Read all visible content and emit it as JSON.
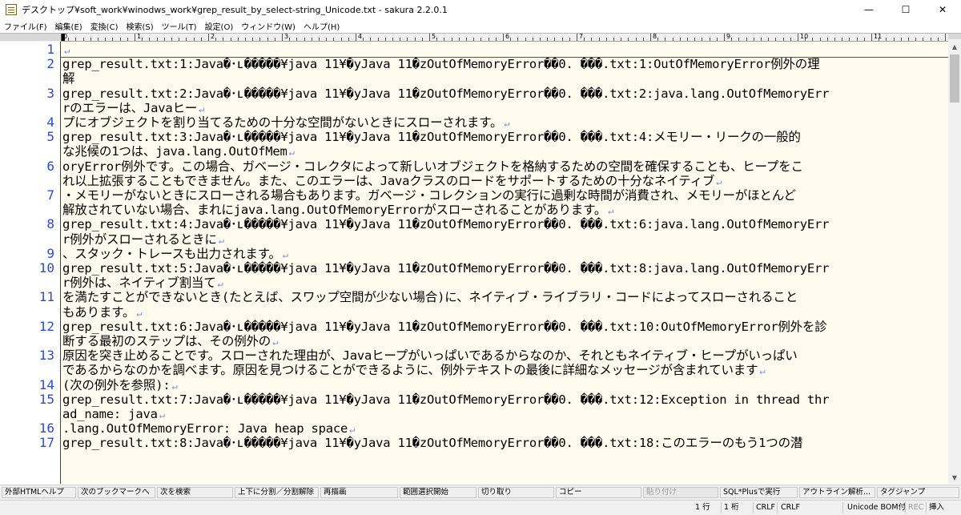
{
  "window": {
    "title": "デスクトップ¥soft_work¥winodws_work¥grep_result_by_select-string_Unicode.txt - sakura 2.2.0.1",
    "min_glyph": "—",
    "max_glyph": "☐",
    "close_glyph": "✕"
  },
  "menu": [
    "ファイル(F)",
    "編集(E)",
    "変換(C)",
    "検索(S)",
    "ツール(T)",
    "設定(O)",
    "ウィンドウ(W)",
    "ヘルプ(H)"
  ],
  "ruler": {
    "labels": [
      "0",
      "1",
      "2",
      "3",
      "4",
      "5",
      "6",
      "7",
      "8",
      "9",
      "10",
      "11",
      "12"
    ]
  },
  "editor": {
    "line_numbers": [
      "1",
      "2",
      "",
      "3",
      "",
      "4",
      "5",
      "",
      "6",
      "",
      "7",
      "",
      "8",
      "",
      "9",
      "10",
      "",
      "11",
      "",
      "12",
      "",
      "13",
      "",
      "14",
      "15",
      "",
      "16",
      "17"
    ],
    "rows": [
      "↵",
      "grep_result.txt:1:Java�･ʟ�����¥java 11¥�yJava 11�zOutOfMemoryError��0. ���.txt:1:OutOfMemoryError例外の理",
      "解",
      "grep_result.txt:2:Java�･ʟ�����¥java 11¥�yJava 11�zOutOfMemoryError��0. ���.txt:2:java.lang.OutOfMemoryErr",
      "rのエラーは、Javaヒー↵",
      "プにオブジェクトを割り当てるための十分な空間がないときにスローされます。↵",
      "grep_result.txt:3:Java�･ʟ�����¥java 11¥�yJava 11�zOutOfMemoryError��0. ���.txt:4:メモリー・リークの一般的",
      "な兆候の1つは、java.lang.OutOfMem↵",
      "oryError例外です。この場合、ガベージ・コレクタによって新しいオブジェクトを格納するための空間を確保することも、ヒープをこ",
      "れ以上拡張することもできません。また、このエラーは、Javaクラスのロードをサポートするための十分なネイティブ↵",
      "・メモリーがないときにスローされる場合もあります。ガベージ・コレクションの実行に過剰な時間が消費され、メモリーがほとんど",
      "解放されていない場合、まれにjava.lang.OutOfMemoryErrorがスローされることがあります。↵",
      "grep_result.txt:4:Java�･ʟ�����¥java 11¥�yJava 11�zOutOfMemoryError��0. ���.txt:6:java.lang.OutOfMemoryErr",
      "r例外がスローされるときに↵",
      "、スタック・トレースも出力されます。↵",
      "grep_result.txt:5:Java�･ʟ�����¥java 11¥�yJava 11�zOutOfMemoryError��0. ���.txt:8:java.lang.OutOfMemoryErr",
      "r例外は、ネイティブ割当て↵",
      "を満たすことができないとき(たとえば、スワップ空間が少ない場合)に、ネイティブ・ライブラリ・コードによってスローされること",
      "もあります。↵",
      "grep_result.txt:6:Java�･ʟ�����¥java 11¥�yJava 11�zOutOfMemoryError��0. ���.txt:10:OutOfMemoryError例外を診",
      "断する最初のステップは、その例外の↵",
      "原因を突き止めることです。スローされた理由が、Javaヒープがいっぱいであるからなのか、それともネイティブ・ヒープがいっぱい",
      "であるからなのかを調べます。原因を見つけることができるように、例外テキストの最後に詳細なメッセージが含まれています↵",
      "(次の例外を参照):↵",
      "grep_result.txt:7:Java�･ʟ�����¥java 11¥�yJava 11�zOutOfMemoryError��0. ���.txt:12:Exception in thread thr",
      "ad_name: java↵",
      ".lang.OutOfMemoryError: Java heap space↵",
      "grep_result.txt:8:Java�･ʟ�����¥java 11¥�yJava 11�zOutOfMemoryError��0. ���.txt:18:このエラーのもう1つの潜"
    ]
  },
  "function_keys": [
    {
      "label": "外部HTMLヘルプ",
      "enabled": true
    },
    {
      "label": "次のブックマークへ",
      "enabled": true
    },
    {
      "label": "次を検索",
      "enabled": true
    },
    {
      "label": "上下に分割／分割解除",
      "enabled": true
    },
    {
      "label": "再描画",
      "enabled": true
    },
    {
      "label": "範囲選択開始",
      "enabled": true
    },
    {
      "label": "切り取り",
      "enabled": true
    },
    {
      "label": "コピー",
      "enabled": true
    },
    {
      "label": "貼り付け",
      "enabled": false
    },
    {
      "label": "SQL*Plusで実行",
      "enabled": true
    },
    {
      "label": "アウトライン解析...",
      "enabled": true
    },
    {
      "label": "タグジャンプ",
      "enabled": true
    }
  ],
  "status": {
    "line": "1 行",
    "column": "1 桁",
    "eol1": "CRLF",
    "eol2": "CRLF",
    "encoding": "Unicode BOM付",
    "rec": "REC",
    "mode": "挿入"
  },
  "colors": {
    "line_number": "#2b4bd6",
    "text_background": "#fffbee",
    "eol_mark": "#6a8fd8"
  }
}
